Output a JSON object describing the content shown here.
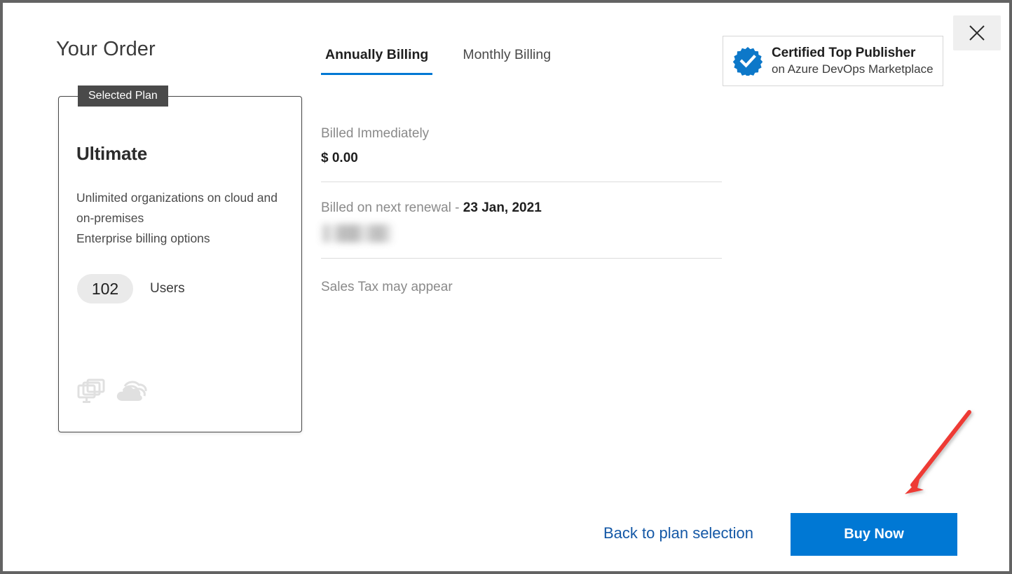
{
  "window": {
    "close_label": "✕"
  },
  "order": {
    "title": "Your Order",
    "selected_tag": "Selected Plan",
    "plan_name": "Ultimate",
    "plan_description": "Unlimited organizations on cloud and on-premises\nEnterprise billing options",
    "plan_description_line1": "Unlimited organizations on cloud and on-premises",
    "plan_description_line2": "Enterprise billing options",
    "users_count": "102",
    "users_label": "Users",
    "deployment_icons": [
      "on-premises-servers-icon",
      "cloud-icon"
    ]
  },
  "billing": {
    "tabs": [
      {
        "label": "Annually Billing",
        "active": true
      },
      {
        "label": "Monthly Billing",
        "active": false
      }
    ],
    "billed_immediately_label": "Billed Immediately",
    "billed_immediately_amount": "$ 0.00",
    "renewal_label": "Billed on next renewal - ",
    "renewal_date": "23 Jan, 2021",
    "renewal_amount_redacted": "",
    "tax_note": "Sales Tax may appear"
  },
  "publisher_badge": {
    "icon": "verified-badge-icon",
    "title": "Certified Top Publisher",
    "subtitle": "on Azure DevOps Marketplace"
  },
  "footer": {
    "back_link": "Back to plan selection",
    "buy_button": "Buy Now"
  },
  "annotation": {
    "arrow": "red-arrow-pointing-to-buy-now"
  },
  "colors": {
    "accent_blue": "#0078D4",
    "link_blue": "#1458A6",
    "tag_gray": "#4A4A4A",
    "pill_gray": "#EAEAEA",
    "muted_text": "#8A8A8A",
    "annotation_red": "#EE3B35"
  }
}
